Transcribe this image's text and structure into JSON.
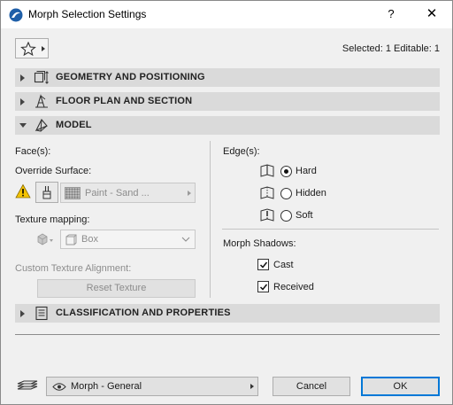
{
  "window": {
    "title": "Morph Selection Settings",
    "help_label": "?",
    "close_label": "✕"
  },
  "header": {
    "selected_info": "Selected: 1 Editable: 1"
  },
  "sections": {
    "geometry": "GEOMETRY AND POSITIONING",
    "floor_plan": "FLOOR PLAN AND SECTION",
    "model": "MODEL",
    "classification": "CLASSIFICATION AND PROPERTIES"
  },
  "model": {
    "faces_label": "Face(s):",
    "override_surface_label": "Override Surface:",
    "surface_value": "Paint - Sand ...",
    "texture_mapping_label": "Texture mapping:",
    "texture_mapping_value": "Box",
    "custom_alignment_label": "Custom Texture Alignment:",
    "reset_texture_label": "Reset Texture",
    "edges_label": "Edge(s):",
    "edge_options": [
      {
        "label": "Hard",
        "selected": true
      },
      {
        "label": "Hidden",
        "selected": false
      },
      {
        "label": "Soft",
        "selected": false
      }
    ],
    "shadows_label": "Morph Shadows:",
    "shadow_cast_label": "Cast",
    "shadow_cast_checked": true,
    "shadow_received_label": "Received",
    "shadow_received_checked": true
  },
  "footer": {
    "favorite_value": "Morph - General",
    "cancel_label": "Cancel",
    "ok_label": "OK"
  },
  "colors": {
    "accent": "#0078d7",
    "section_bg": "#dadada",
    "warning": "#f5c400"
  }
}
